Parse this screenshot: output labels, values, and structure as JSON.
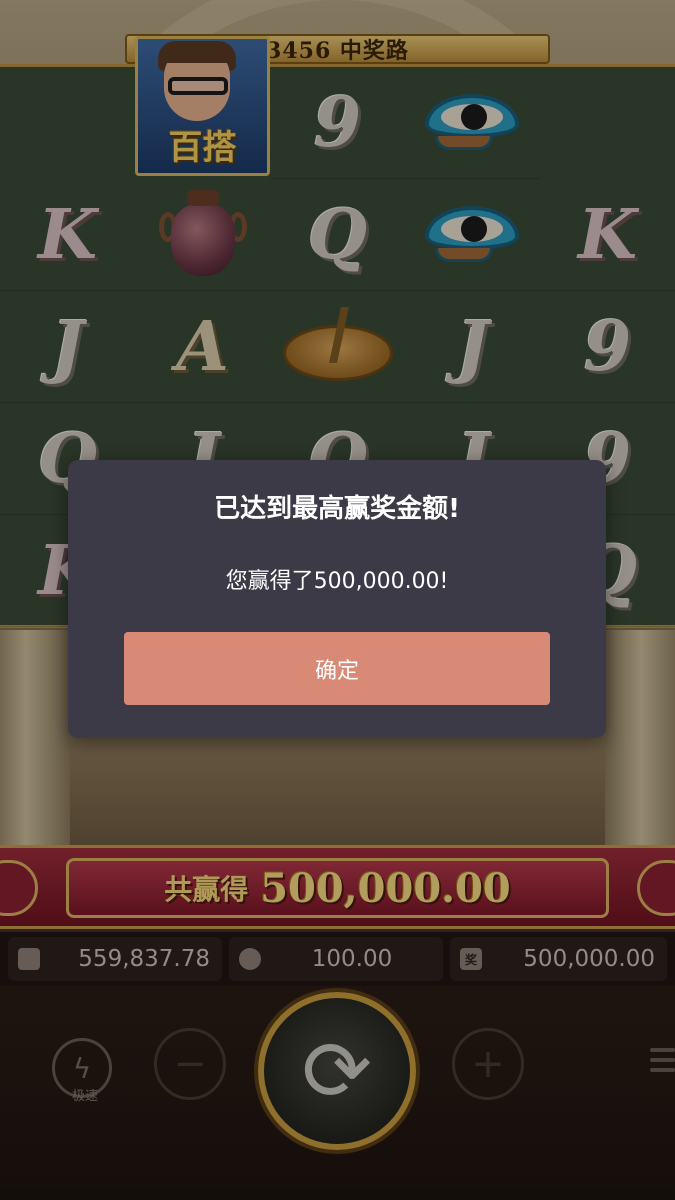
{
  "game": {
    "ways_label": "3456 中奖路",
    "hero_symbol_label": "百搭"
  },
  "reels": {
    "col1": [
      "K",
      "J",
      "Q",
      "K"
    ],
    "col2": [
      "百搭",
      "vase",
      "A",
      "J"
    ],
    "col3": [
      "9",
      "Q",
      "sundial",
      "Q"
    ],
    "col4": [
      "eye",
      "eye",
      "J",
      "J"
    ],
    "col5": [
      "K",
      "9",
      "9",
      "Q"
    ]
  },
  "popup": {
    "title": "已达到最高赢奖金额!",
    "message": "您赢得了500,000.00!",
    "confirm_label": "确定"
  },
  "win_banner": {
    "label": "共赢得",
    "amount": "500,000.00"
  },
  "stats": {
    "balance": "559,837.78",
    "bet": "100.00",
    "win": "500,000.00",
    "win_icon_text": "奖"
  },
  "controls": {
    "turbo_label": "极速",
    "minus_symbol": "−",
    "plus_symbol": "+",
    "spin_symbol": "⟳"
  }
}
